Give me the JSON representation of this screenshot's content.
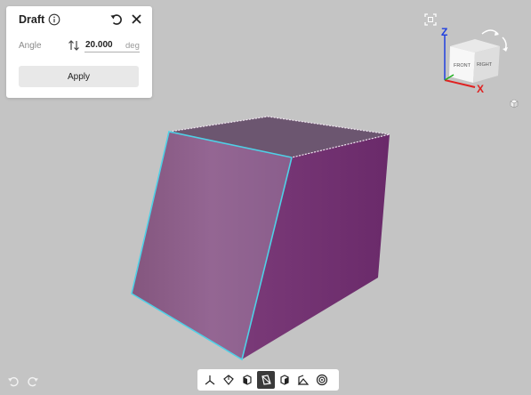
{
  "panel": {
    "title": "Draft",
    "angle_label": "Angle",
    "angle_value": "20.000",
    "unit": "deg",
    "apply_label": "Apply",
    "icons": {
      "info": "info-icon",
      "reset": "undo-icon",
      "close": "close-icon",
      "swap": "swap-arrows-icon"
    }
  },
  "viewcube": {
    "front_label": "FRONT",
    "right_label": "RIGHT",
    "axis_z": "Z",
    "axis_x": "X",
    "axis_colors": {
      "x": "#e02020",
      "y": "#20b020",
      "z": "#2040e0"
    }
  },
  "toolbar": {
    "tools": [
      "axis-triad-icon",
      "box-view-icon",
      "wireframe-view-icon",
      "shaded-view-icon",
      "section-view-icon",
      "perspective-view-icon",
      "render-mode-icon"
    ],
    "active_index": 3
  },
  "history": [
    "undo-icon",
    "redo-icon"
  ],
  "colors": {
    "background": "#c4c4c4",
    "face_front": "#8e6090",
    "face_right": "#722e70",
    "face_top": "#6c5670",
    "selected_edge": "#4fd0e6"
  }
}
